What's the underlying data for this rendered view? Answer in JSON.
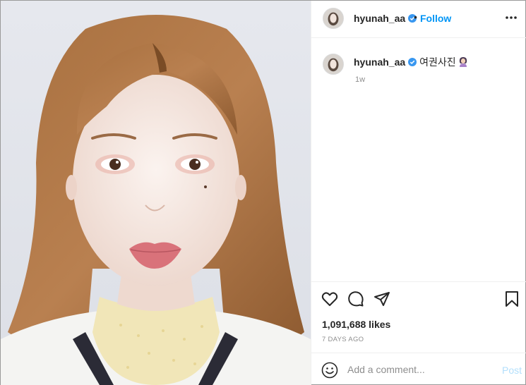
{
  "photo": {
    "alt": "portrait photo"
  },
  "header": {
    "username": "hyunah_aa",
    "separator": "•",
    "follow_label": "Follow"
  },
  "caption": {
    "username": "hyunah_aa",
    "text": "여권사진",
    "time": "1w"
  },
  "stats": {
    "likes": "1,091,688 likes",
    "posted": "7 DAYS AGO"
  },
  "comment": {
    "placeholder": "Add a comment...",
    "post_label": "Post"
  },
  "colors": {
    "follow": "#0095f6",
    "verified": "#3897f0",
    "post_disabled": "#b2dffc",
    "divider": "#efefef",
    "muted": "#8e8e8e"
  },
  "icons": [
    "verified-badge-icon",
    "more-options-icon",
    "heart-icon",
    "comment-icon",
    "share-icon",
    "bookmark-icon",
    "emoji-smile-icon",
    "woman-emoji-icon"
  ]
}
